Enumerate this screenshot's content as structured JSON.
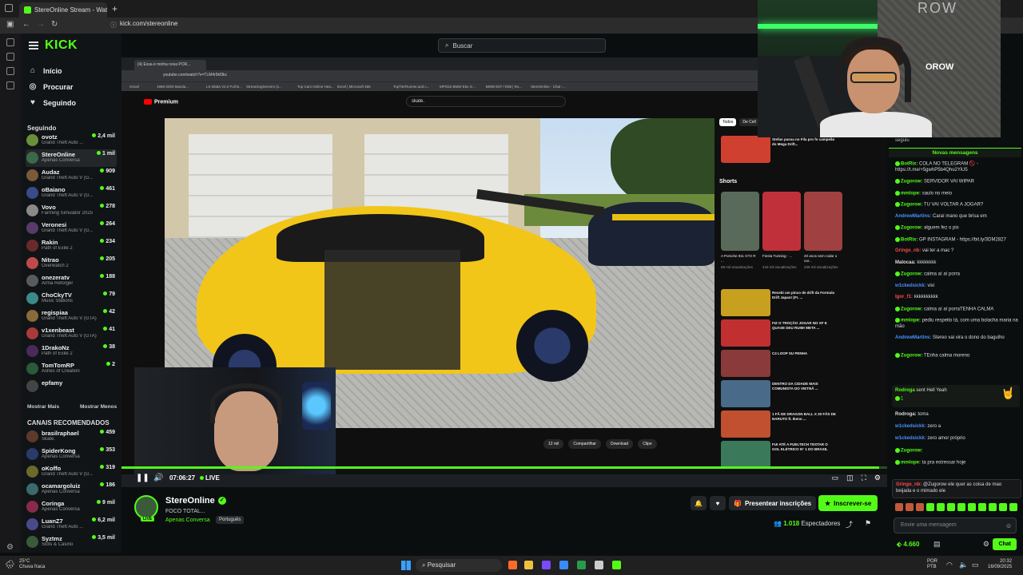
{
  "browser": {
    "tab_title": "StereOnline Stream - Watch",
    "url": "kick.com/stereonline"
  },
  "sidebar": {
    "logo": "KICK",
    "nav": [
      {
        "label": "Início",
        "icon": "home-icon"
      },
      {
        "label": "Procurar",
        "icon": "compass-icon"
      },
      {
        "label": "Seguindo",
        "icon": "heart-icon"
      }
    ],
    "following_title": "Seguindo",
    "following": [
      {
        "name": "ovotz",
        "game": "Grand Theft Auto ...",
        "viewers": "2,4 mil",
        "color": "#6a8f3a"
      },
      {
        "name": "StereOnline",
        "game": "Apenas Conversa",
        "viewers": "1 mil",
        "color": "#3a6a4a"
      },
      {
        "name": "Audaz",
        "game": "Grand Theft Auto V (G...",
        "viewers": "909",
        "color": "#7a5a3a"
      },
      {
        "name": "oBaiano",
        "game": "Grand Theft Auto V (G...",
        "viewers": "461",
        "color": "#3a4a8a"
      },
      {
        "name": "Vovo",
        "game": "Farming Simulator 2025",
        "viewers": "278",
        "color": "#8a8a8a"
      },
      {
        "name": "Veronesi",
        "game": "Grand Theft Auto V (G...",
        "viewers": "264",
        "color": "#5a3a6a"
      },
      {
        "name": "Rakin",
        "game": "Path of Exile 2",
        "viewers": "234",
        "color": "#6a2a2a"
      },
      {
        "name": "Nitrao",
        "game": "Overwatch 2",
        "viewers": "205",
        "color": "#c04a4a"
      },
      {
        "name": "onezeratv",
        "game": "Arma Reforger",
        "viewers": "188",
        "color": "#5a5a5a"
      },
      {
        "name": "ChoCkyTV",
        "game": "Music Stations",
        "viewers": "79",
        "color": "#3a8a8a"
      },
      {
        "name": "regispiaa",
        "game": "Grand Theft Auto V (GTA)",
        "viewers": "42",
        "color": "#8a6a3a"
      },
      {
        "name": "v1xenbeast",
        "game": "Grand Theft Auto V (GTA)",
        "viewers": "41",
        "color": "#aa3a3a"
      },
      {
        "name": "1DrakoNz",
        "game": "Path of Exile 2",
        "viewers": "38",
        "color": "#4a2a5a"
      },
      {
        "name": "TomTomRP",
        "game": "Ashes of Creation",
        "viewers": "2",
        "color": "#2a5a3a"
      },
      {
        "name": "epfamy",
        "game": "",
        "viewers": "",
        "color": "#444444"
      }
    ],
    "show_more": "Mostrar Mais",
    "show_less": "Mostrar Menos",
    "recommended_title": "CANAIS RECOMENDADOS",
    "recommended": [
      {
        "name": "brasilraphael",
        "game": "Skate.",
        "viewers": "459",
        "color": "#5a3a2a"
      },
      {
        "name": "SpiderKong",
        "game": "Apenas Conversa",
        "viewers": "353",
        "color": "#2a3a6a"
      },
      {
        "name": "oKoffo",
        "game": "Grand Theft Auto V (G...",
        "viewers": "319",
        "color": "#6a6a2a"
      },
      {
        "name": "ocamargoluiz",
        "game": "Apenas Conversa",
        "viewers": "186",
        "color": "#3a6a6a"
      },
      {
        "name": "Coringa",
        "game": "Apenas Conversa",
        "viewers": "9 mil",
        "color": "#8a2a4a"
      },
      {
        "name": "LuanZ7",
        "game": "Grand Theft Auto ...",
        "viewers": "6,2 mil",
        "color": "#4a4a8a"
      },
      {
        "name": "Syztmz",
        "game": "Slots & Casino",
        "viewers": "3,5 mil",
        "color": "#3a5a3a"
      }
    ]
  },
  "search": {
    "placeholder": "Buscar"
  },
  "video": {
    "inner_url": "youtube.com/watch?v=TLM4r5kI9kc",
    "inner_tab": "(4) Essa é minha nova POR...",
    "bookmarks": [
      "Gmail",
      "1986-2003 Mazda...",
      "LS Miata V2.0 Full B...",
      "StreamingServers (s...",
      "Top Cars Online Hea...",
      "Excel | Microsoft 365",
      "TopTierRunner.and c...",
      "MPG52 BMW E6x G...",
      "BMW E87 / E88 | Ro...",
      "StereOnline - Chat -..."
    ],
    "yt_brand": "Premium",
    "yt_search": "skate.",
    "chips": [
      "Todos",
      "De Cell"
    ],
    "shorts_title": "Shorts",
    "shorts": [
      {
        "caption": "A Porsche 911 GT2 R ...",
        "views": "68 mil visualizações",
        "color": "#5a6a5a"
      },
      {
        "caption": "Fiesta Tunning - ...",
        "views": "243 mil visualizações",
        "color": "#c0303a"
      },
      {
        "caption": "20 anos sem rodar o car...",
        "views": "239 mil visualizações",
        "color": "#a04040"
      }
    ],
    "recs": [
      {
        "title": "Stefan passa no Fila pro fo campeão do Mega Drift...",
        "color": "#d04030"
      },
      {
        "title": "Recebi um pinco de drift da Formula Drift Japan! (Ft. ...",
        "color": "#c8a020"
      },
      {
        "title": "FIZ O TROÇÃO JOGAR NO XF E QUASE DEU RUIM! META ...",
        "color": "#c03030"
      },
      {
        "title": "C4 LOOP SU PENHA",
        "color": "#8a3a3a"
      },
      {
        "title": "DENTRO DA CIDADE MAIS COMUNISTA DO VIETNÃ ...",
        "color": "#4a6a8a"
      },
      {
        "title": "1 FÃ DE DRAGON BALL X 20 FÃS DE NARUTO ft. Ikeno ...",
        "color": "#c05030"
      },
      {
        "title": "FUI ATÉ A FUELTECH TESTAR O GOL ELÉTRICO N° 1 DO BRASIL",
        "color": "#3a7a5a"
      }
    ],
    "actions": [
      "12 mil",
      "Compartilhar",
      "Download",
      "Clipe"
    ],
    "time": "07:06:27",
    "live_label": "LIVE",
    "progress": 0.99
  },
  "channel": {
    "name": "StereOnline",
    "subtitle": "FOCO TOTAL...",
    "category": "Apenas Conversa",
    "language": "Português",
    "gift_label": "Presentear inscrições",
    "subscribe_label": "Inscrever-se",
    "viewers_count": "1.018",
    "viewers_label": "Espectadores",
    "live_badge": "LIVE"
  },
  "webcam": {
    "brand": "ROW",
    "logo": "OROW"
  },
  "chat": {
    "top_text": "seguiu",
    "new_messages": "Novas mensagens",
    "messages": [
      {
        "user": "BotRix:",
        "text": "COLA NO TELEGRAM 🚫 - https://t.me/+5gwhP5b4Qho2YiU5",
        "color": "#53fc18",
        "badge": true
      },
      {
        "user": "Zugorow:",
        "text": "SERVIDOR VAI WIPAR",
        "color": "#53fc18",
        "badge": true
      },
      {
        "user": "mmlope:",
        "text": "saulo no meio",
        "color": "#53fc18",
        "badge": true
      },
      {
        "user": "Zugorow:",
        "text": "TU VAI VOLTAR A JOGAR?",
        "color": "#53fc18",
        "badge": true
      },
      {
        "user": "AndrewMartins:",
        "text": "Caraí mano que brisa em",
        "color": "#4a90ff",
        "badge": false
      },
      {
        "user": "Zugorow:",
        "text": "alguem fez o pix",
        "color": "#53fc18",
        "badge": true
      },
      {
        "user": "BotRix:",
        "text": "GP INSTAGRAM - https://bit.ly/3DM2827",
        "color": "#53fc18",
        "badge": true
      },
      {
        "user": "Gringo_nb:",
        "text": "vai ter a mac ?",
        "color": "#ff4a4a",
        "badge": false
      },
      {
        "user": "Malocaa:",
        "text": "kkkkkkkk",
        "color": "#dddddd",
        "badge": false
      },
      {
        "user": "Zugorow:",
        "text": "calma aí aí porra",
        "color": "#53fc18",
        "badge": true
      },
      {
        "user": "w1ckedsickk:",
        "text": "vixi",
        "color": "#4a90ff",
        "badge": false
      },
      {
        "user": "Igor_f1:",
        "text": "kkkkkkkkkk",
        "color": "#ff4a4a",
        "badge": false
      },
      {
        "user": "Zugorow:",
        "text": "calma aí aí porraTENHA CALMA",
        "color": "#53fc18",
        "badge": true
      },
      {
        "user": "mmlope:",
        "text": "pediu respeito tá, com uma bolacha maria na mão",
        "color": "#53fc18",
        "badge": true
      },
      {
        "user": "AndrewMartins:",
        "text": "Stereo vai vira o dono do bagulho",
        "color": "#4a90ff",
        "badge": false
      },
      {
        "user": "Zugorow:",
        "text": "TEnha calma moreno",
        "color": "#53fc18",
        "badge": true
      }
    ],
    "highlight_user": "Rodroga",
    "highlight_text": "sent Hell Yeah",
    "highlight_count": "1",
    "messages2": [
      {
        "user": "Rodroga:",
        "text": "toma",
        "color": "#dddddd",
        "badge": false
      },
      {
        "user": "w1ckedsickk:",
        "text": "zero a",
        "color": "#4a90ff",
        "badge": false
      },
      {
        "user": "w1ckedsickk:",
        "text": "zero amor próprio",
        "color": "#4a90ff",
        "badge": false
      },
      {
        "user": "Zugorow:",
        "text": "",
        "color": "#53fc18",
        "badge": true
      },
      {
        "user": "mmlope:",
        "text": "ta pra estressar hoje",
        "color": "#53fc18",
        "badge": true
      }
    ],
    "reply_user": "Gringo_nb:",
    "reply_text": "@Zugorow ele quer as coisa de mao beijada e o mimado ele",
    "input_placeholder": "Envie uma mensagem",
    "points": "4.660",
    "chat_button": "Chat"
  },
  "os": {
    "weather_temp": "25°C",
    "weather_desc": "Chuva fraca",
    "search_label": "Pesquisar",
    "lang": "POR",
    "layout": "PTB",
    "time": "20:32",
    "date": "16/09/2025"
  }
}
